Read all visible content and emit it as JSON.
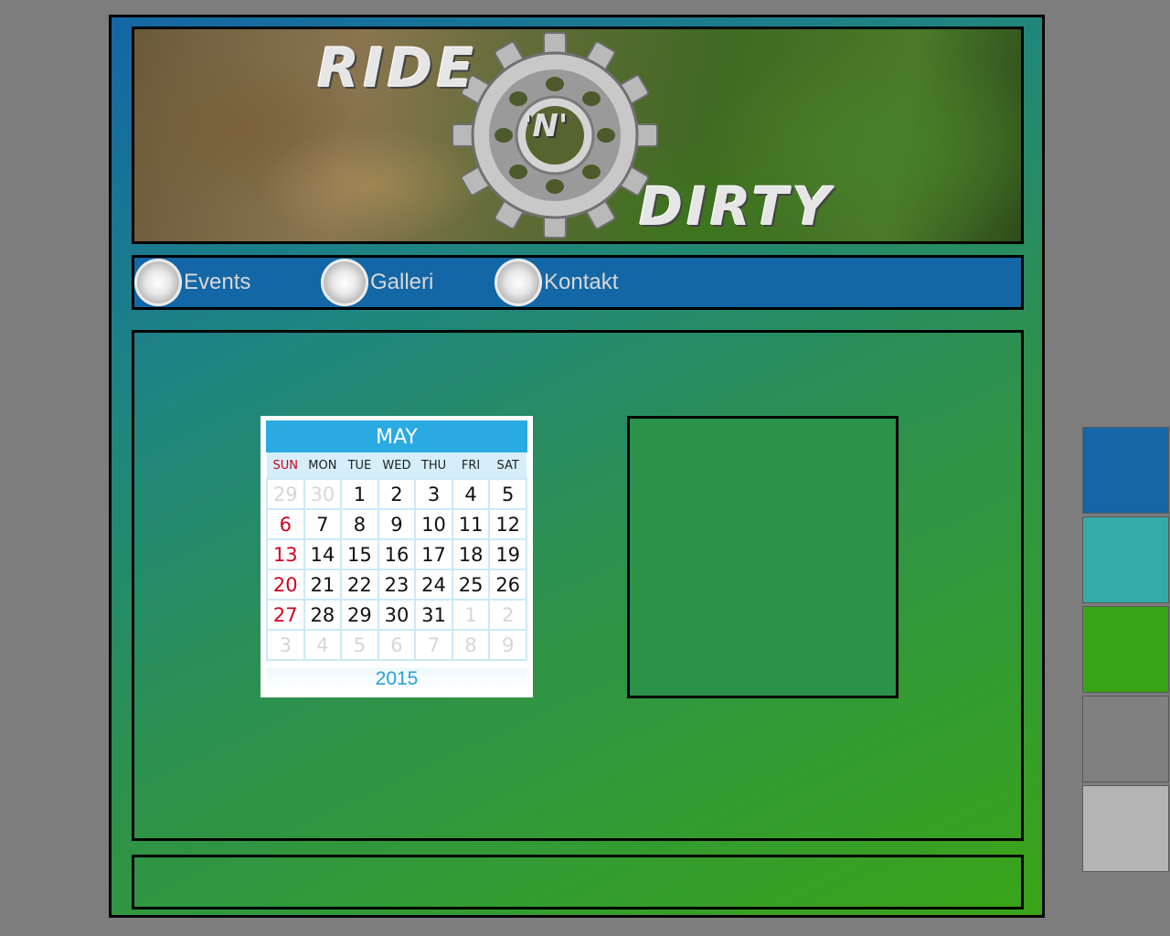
{
  "banner": {
    "brand_ride": "RIDE",
    "brand_n": "'N'",
    "brand_dirty": "DIRTY"
  },
  "nav": {
    "items": [
      {
        "label": "Events",
        "icon": "cassette-cog-icon"
      },
      {
        "label": "Galleri",
        "icon": "cassette-cog-icon"
      },
      {
        "label": "Kontakt",
        "icon": "cassette-cog-icon"
      }
    ]
  },
  "calendar": {
    "month": "MAY",
    "year": "2015",
    "weekdays": [
      "SUN",
      "MON",
      "TUE",
      "WED",
      "THU",
      "FRI",
      "SAT"
    ],
    "weeks": [
      [
        "29",
        "30",
        "1",
        "2",
        "3",
        "4",
        "5"
      ],
      [
        "6",
        "7",
        "8",
        "9",
        "10",
        "11",
        "12"
      ],
      [
        "13",
        "14",
        "15",
        "16",
        "17",
        "18",
        "19"
      ],
      [
        "20",
        "21",
        "22",
        "23",
        "24",
        "25",
        "26"
      ],
      [
        "27",
        "28",
        "29",
        "30",
        "31",
        "1",
        "2"
      ],
      [
        "3",
        "4",
        "5",
        "6",
        "7",
        "8",
        "9"
      ]
    ]
  },
  "palette": [
    "#1466a6",
    "#33aaaa",
    "#38a316",
    "#808080",
    "#b4b4b4"
  ]
}
